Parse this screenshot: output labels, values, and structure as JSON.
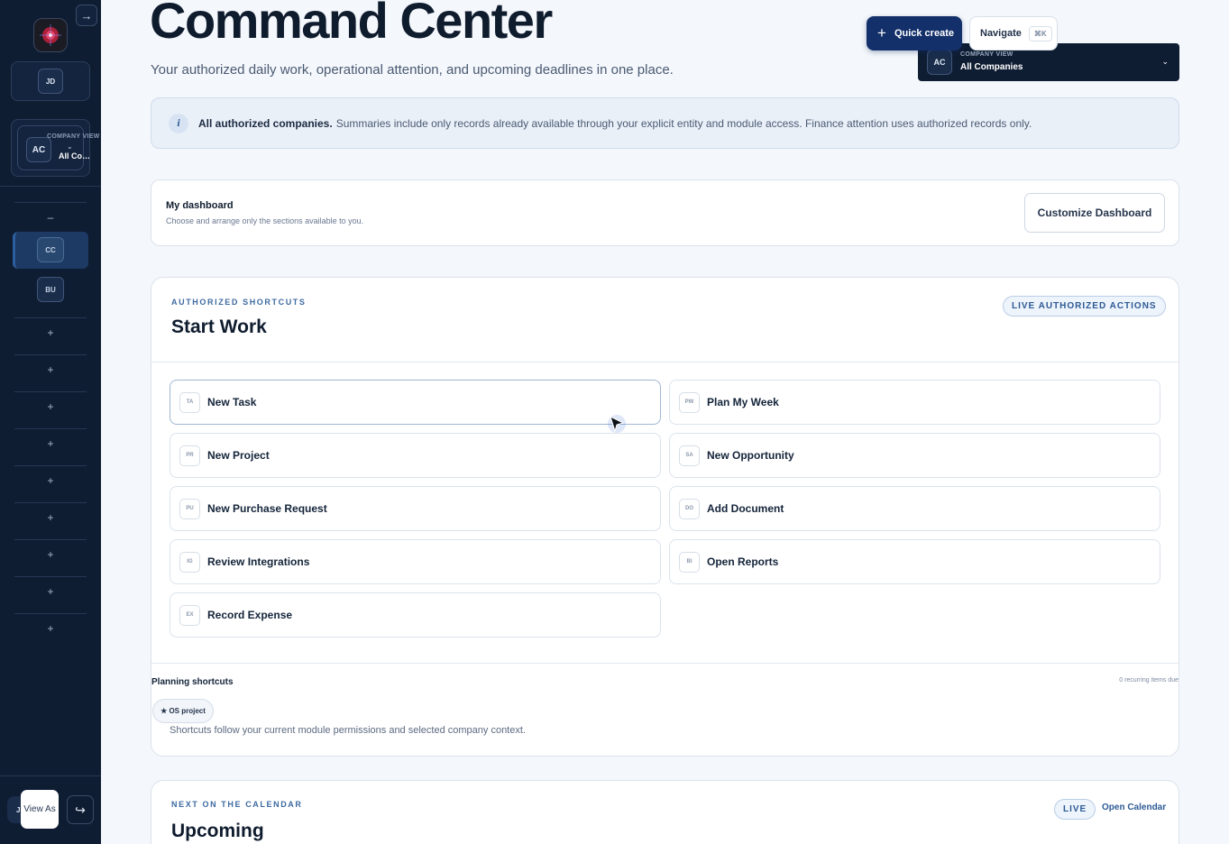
{
  "sidebar": {
    "collapse_icon": "→",
    "user_initials": "JD",
    "company": {
      "initials": "AC",
      "label": "COMPANY VIEW",
      "name": "All Companies",
      "chevron": "⌄"
    },
    "nav": [
      {
        "type": "toggle",
        "glyph": "–"
      },
      {
        "type": "icon",
        "abbr": "CC",
        "active": true
      },
      {
        "type": "icon",
        "abbr": "BU"
      },
      {
        "type": "add",
        "glyph": "+"
      },
      {
        "type": "add",
        "glyph": "+"
      },
      {
        "type": "add",
        "glyph": "+"
      },
      {
        "type": "add",
        "glyph": "+"
      },
      {
        "type": "add",
        "glyph": "+"
      },
      {
        "type": "add",
        "glyph": "+"
      },
      {
        "type": "add",
        "glyph": "+"
      },
      {
        "type": "add",
        "glyph": "+"
      },
      {
        "type": "add",
        "glyph": "+"
      }
    ],
    "bottom": {
      "avatar_initial": "J",
      "view_as_label": "View As",
      "logout_icon": "↪"
    }
  },
  "header": {
    "title": "Command Center",
    "subtitle": "Your authorized daily work, operational attention, and upcoming deadlines in one place.",
    "quick_create": "Quick create",
    "navigate": "Navigate",
    "navigate_shortcut": "⌘K",
    "company_select": {
      "initials": "AC",
      "label": "COMPANY VIEW",
      "name": "All Companies",
      "chevron": "⌄"
    }
  },
  "banner": {
    "icon": "i",
    "strong": "All authorized companies.",
    "text": "Summaries include only records already available through your explicit entity and module access. Finance attention uses authorized records only."
  },
  "dashboard": {
    "title": "My dashboard",
    "subtitle": "Choose and arrange only the sections available to you.",
    "customize": "Customize Dashboard"
  },
  "start_work": {
    "eyebrow": "AUTHORIZED SHORTCUTS",
    "title": "Start Work",
    "pill": "LIVE AUTHORIZED ACTIONS",
    "actions": [
      {
        "abbr": "TA",
        "label": "New Task"
      },
      {
        "abbr": "PW",
        "label": "Plan My Week"
      },
      {
        "abbr": "PR",
        "label": "New Project"
      },
      {
        "abbr": "SA",
        "label": "New Opportunity"
      },
      {
        "abbr": "PU",
        "label": "New Purchase Request"
      },
      {
        "abbr": "DO",
        "label": "Add Document"
      },
      {
        "abbr": "IG",
        "label": "Review Integrations"
      },
      {
        "abbr": "BI",
        "label": "Open Reports"
      },
      {
        "abbr": "EX",
        "label": "Record Expense"
      }
    ],
    "planning": {
      "title": "Planning shortcuts",
      "due": "0 recurring items due",
      "chip": "★ OS project",
      "note": "Shortcuts follow your current module permissions and selected company context."
    }
  },
  "upcoming": {
    "eyebrow": "NEXT ON THE CALENDAR",
    "title": "Upcoming",
    "pill": "LIVE",
    "open_calendar": "Open Calendar"
  },
  "colors": {
    "sidebar_bg": "#0f1d33",
    "primary": "#13306a",
    "accent": "#2d5a95",
    "page_bg": "#f4f7fb"
  }
}
